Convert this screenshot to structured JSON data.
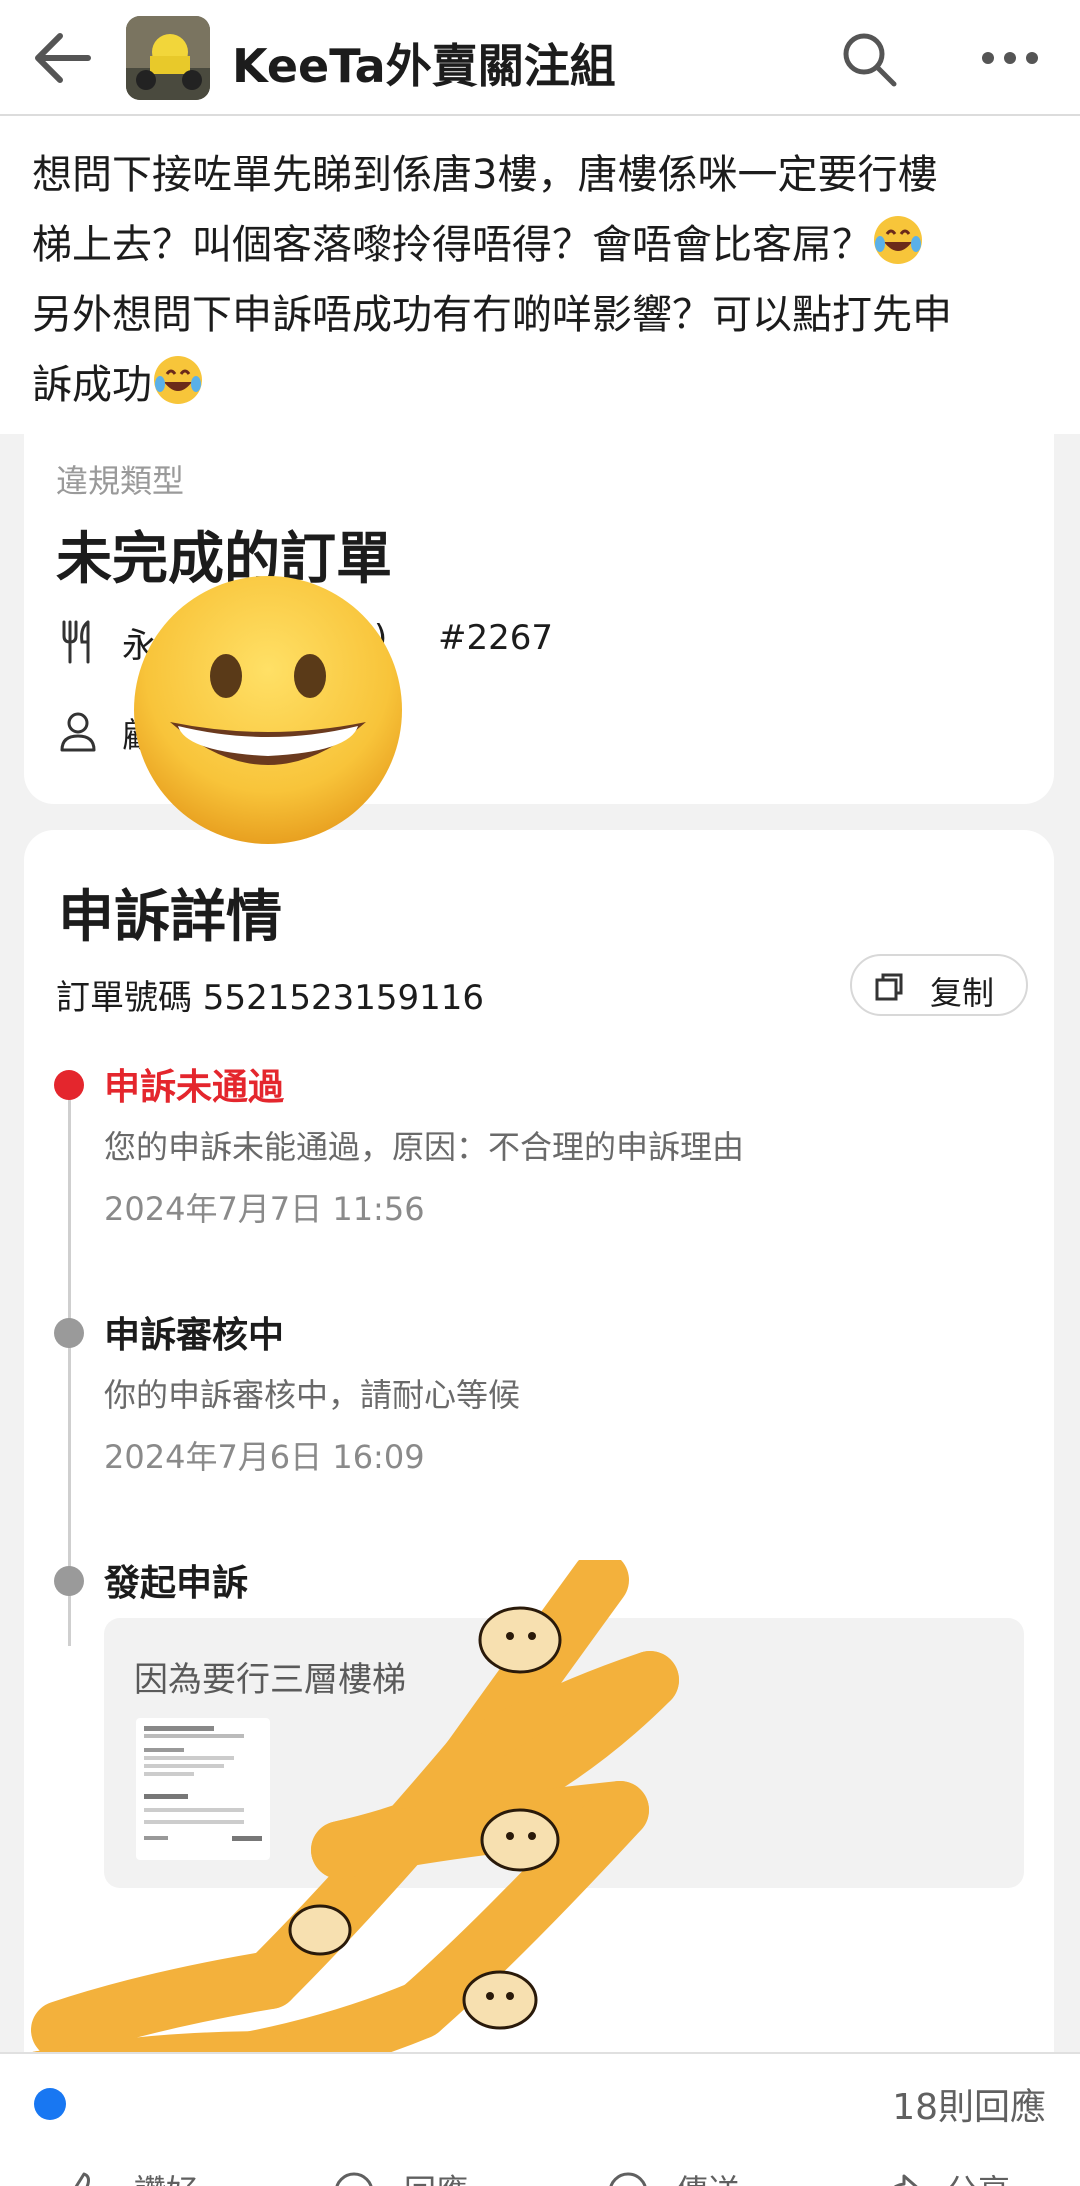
{
  "header": {
    "group_name": "KeeTa外賣關注組",
    "back_icon": "arrow-left-icon",
    "search_icon": "search-icon",
    "more_icon": "more-horizontal-icon"
  },
  "post": {
    "lines": [
      "想問下接咗單先睇到係唐3樓，唐樓係咪一定要行樓",
      "梯上去？叫個客落嚟拎得唔得？會唔會比客屌？",
      "另外想問下申訴唔成功有冇啲咩影響？可以點打先申",
      "訴成功"
    ]
  },
  "violation_card": {
    "type_label": "違規類型",
    "type_value": "未完成的訂單",
    "shop_fragment": "永",
    "shop_close_paren": ")",
    "order_tag": "#2267",
    "customer_fragment": "顧"
  },
  "appeal": {
    "title": "申訴詳情",
    "order_number_text": "訂單號碼 5521523159116",
    "copy_label": "复制",
    "timeline": [
      {
        "status": "申訴未通過",
        "desc": "您的申訴未能通過，原因：不合理的申訴理由",
        "time": "2024年7月7日  11:56",
        "color": "#e4262d"
      },
      {
        "status": "申訴審核中",
        "desc": "你的申訴審核中，請耐心等候",
        "time": "2024年7月6日  16:09",
        "color": "#1c1c1c"
      },
      {
        "status": "發起申訴"
      }
    ],
    "reason": "因為要行三層樓梯"
  },
  "footer": {
    "reply_count": "18則回應",
    "actions": [
      "讚好",
      "回應",
      "傳送",
      "分享"
    ]
  },
  "colors": {
    "accent_red": "#e4262d",
    "timeline_gray": "#9a9a9a",
    "scribble_orange": "#f3b13c"
  }
}
